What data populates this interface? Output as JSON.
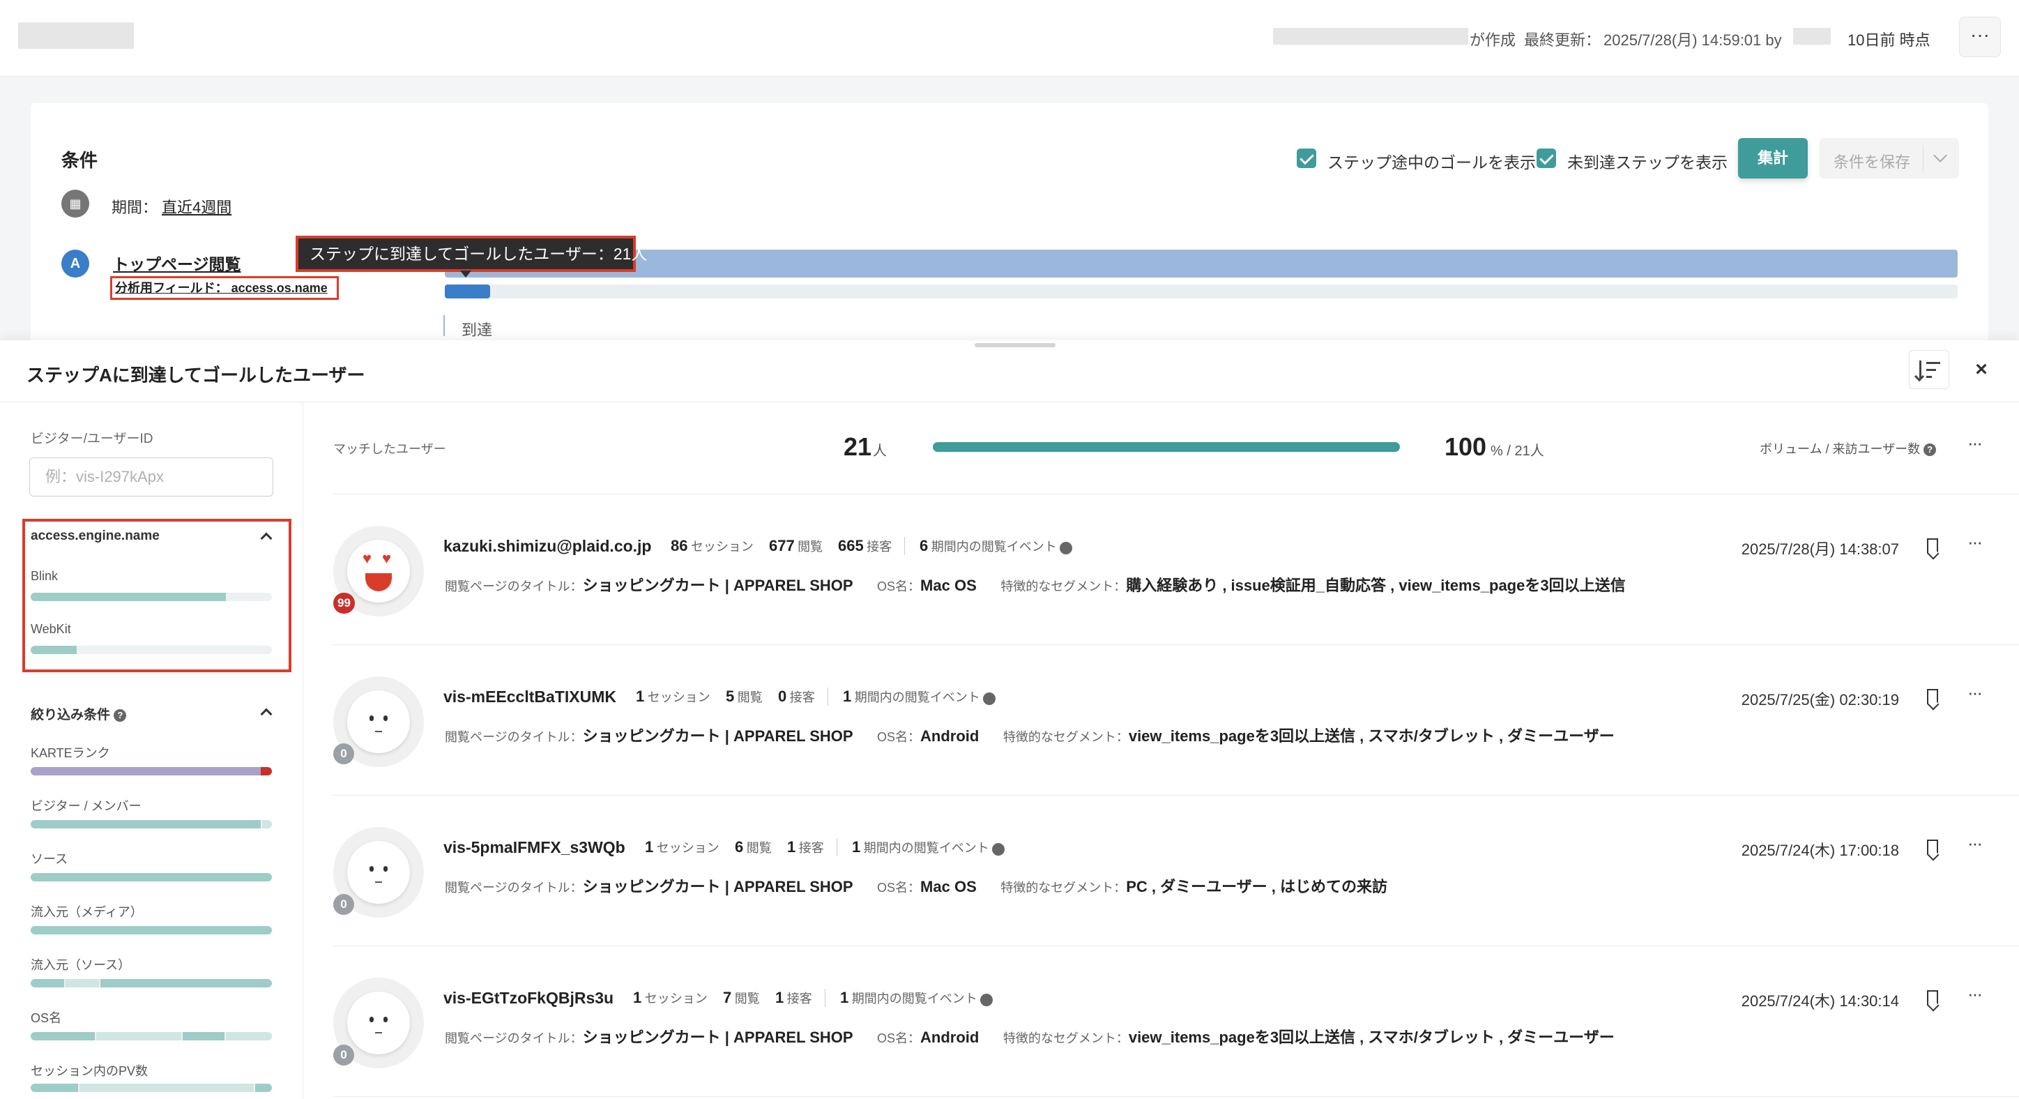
{
  "header": {
    "created_suffix": "が作成",
    "last_updated_label": "最終更新：",
    "last_updated_value": "2025/7/28(月) 14:59:01 by",
    "as_of": "10日前 時点",
    "more_icon": "ellipsis-icon"
  },
  "conditions": {
    "title": "条件",
    "show_goals_label": "ステップ途中のゴールを表示",
    "show_unreached_label": "未到達ステップを表示",
    "aggregate_label": "集計",
    "save_label": "条件を保存",
    "period_label": "期間：",
    "period_value": "直近4週間",
    "period_icon": "calendar-icon",
    "step_a": {
      "badge": "A",
      "title": "トップページ閲覧",
      "field": "分析用フィールド： access.os.name",
      "tooltip": "ステップに到達してゴールしたユーザー：21人",
      "goal_ratio": 0.03
    },
    "reach_label": "到達"
  },
  "panel": {
    "title": "ステップAに到達してゴールしたユーザー",
    "close_label": "×",
    "sort_icon": "sort-icon"
  },
  "sidebar": {
    "visitor_label": "ビジター/ユーザーID",
    "visitor_placeholder": "例：vis-I297kApx",
    "engine": {
      "title": "access.engine.name",
      "items": [
        {
          "label": "Blink",
          "ratio": 0.81
        },
        {
          "label": "WebKit",
          "ratio": 0.19
        }
      ]
    },
    "filters": {
      "title": "絞り込み条件",
      "items": [
        {
          "label": "KARTEランク"
        },
        {
          "label": "ビジター / メンバー"
        },
        {
          "label": "ソース"
        },
        {
          "label": "流入元（メディア）"
        },
        {
          "label": "流入元（ソース）"
        },
        {
          "label": "OS名"
        },
        {
          "label": "セッション内のPV数"
        }
      ]
    }
  },
  "summary": {
    "matched_label": "マッチしたユーザー",
    "matched_count": "21",
    "matched_unit": "人",
    "percent": "100",
    "percent_unit": "% / 21人",
    "ratio": 1.0,
    "volume_label": "ボリューム / 来訪ユーザー数"
  },
  "labels": {
    "session": "セッション",
    "view": "閲覧",
    "contact": "接客",
    "period_events": "期間内の閲覧イベント",
    "page_title": "閲覧ページのタイトル：",
    "os": "OS名：",
    "segment": "特徴的なセグメント："
  },
  "users": [
    {
      "id": "kazuki.shimizu@plaid.co.jp",
      "badge": "99",
      "sessions": "86",
      "views": "677",
      "contacts": "665",
      "events": "6",
      "page_title": "ショッピングカート | APPAREL SHOP",
      "os": "Mac OS",
      "segments": "購入経験あり , issue検証用_自動応答 , view_items_pageを3回以上送信",
      "date": "2025/7/28(月) 14:38:07"
    },
    {
      "id": "vis-mEEccltBaTIXUMK",
      "badge": "0",
      "sessions": "1",
      "views": "5",
      "contacts": "0",
      "events": "1",
      "page_title": "ショッピングカート | APPAREL SHOP",
      "os": "Android",
      "segments": "view_items_pageを3回以上送信 , スマホ/タブレット , ダミーユーザー",
      "date": "2025/7/25(金) 02:30:19"
    },
    {
      "id": "vis-5pmaIFMFX_s3WQb",
      "badge": "0",
      "sessions": "1",
      "views": "6",
      "contacts": "1",
      "events": "1",
      "page_title": "ショッピングカート | APPAREL SHOP",
      "os": "Mac OS",
      "segments": "PC , ダミーユーザー , はじめての来訪",
      "date": "2025/7/24(木) 17:00:18"
    },
    {
      "id": "vis-EGtTzoFkQBjRs3u",
      "badge": "0",
      "sessions": "1",
      "views": "7",
      "contacts": "1",
      "events": "1",
      "page_title": "ショッピングカート | APPAREL SHOP",
      "os": "Android",
      "segments": "view_items_pageを3回以上送信 , スマホ/タブレット , ダミーユーザー",
      "date": "2025/7/24(木) 14:30:14"
    }
  ],
  "colors": {
    "accent": "#3f9c9a",
    "step_blue": "#3a7dc9",
    "highlight_red": "#d93d2a"
  }
}
